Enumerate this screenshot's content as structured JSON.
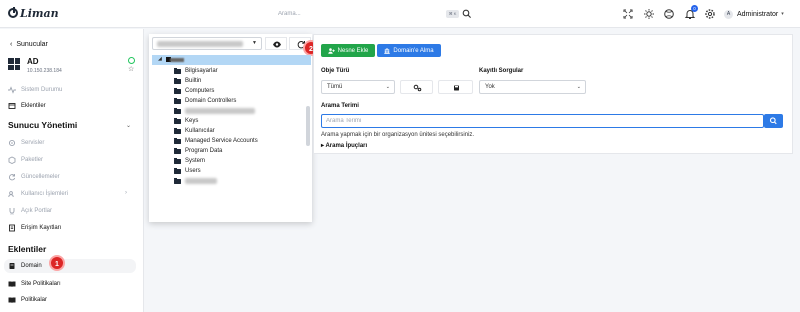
{
  "header": {
    "logo_text": "Liman",
    "search_placeholder": "Arama...",
    "search_shortcut": "⌘ K",
    "notification_count": "0",
    "user_initial": "A",
    "user_name": "Administrator"
  },
  "sidebar": {
    "back_label": "Sunucular",
    "server": {
      "name": "AD",
      "ip": "10.150.238.184"
    },
    "items_top": [
      {
        "label": "Sistem Durumu",
        "icon": "pulse-icon"
      },
      {
        "label": "Eklentiler",
        "icon": "plugin-icon"
      }
    ],
    "section_management": "Sunucu Yönetimi",
    "items_management": [
      {
        "label": "Servisler",
        "icon": "services-icon"
      },
      {
        "label": "Paketler",
        "icon": "package-icon"
      },
      {
        "label": "Güncellemeler",
        "icon": "update-icon"
      },
      {
        "label": "Kullanıcı İşlemleri",
        "icon": "users-icon"
      },
      {
        "label": "Açık Portlar",
        "icon": "port-icon"
      },
      {
        "label": "Erişim Kayıtları",
        "icon": "log-icon"
      }
    ],
    "section_plugins": "Eklentiler",
    "items_plugins": [
      {
        "label": "Domain",
        "icon": "domain-icon"
      },
      {
        "label": "Site Politikaları",
        "icon": "book-icon"
      },
      {
        "label": "Politikalar",
        "icon": "book-icon"
      }
    ]
  },
  "tree": {
    "items": [
      "Bilgisayarlar",
      "",
      "Builtin",
      "Computers",
      "Domain Controllers",
      "",
      "Keys",
      "Kullanıcılar",
      "Managed Service Accounts",
      "Program Data",
      "System",
      "Users",
      ""
    ]
  },
  "actions": {
    "add_object": "Nesne Ekle",
    "join_domain": "Domain'e Alma"
  },
  "form": {
    "object_type_label": "Obje Türü",
    "object_type_value": "Tümü",
    "saved_queries_label": "Kayıtlı Sorgular",
    "saved_queries_value": "Yok",
    "search_term_label": "Arama Terimi",
    "search_term_placeholder": "Arama Terimi",
    "hint": "Arama yapmak için bir organizasyon ünitesi seçebilirsiniz.",
    "tips": "Arama İpuçları"
  },
  "annotations": {
    "badge1": "1",
    "badge2": "2"
  },
  "colors": {
    "accent_blue": "#2d7ae6",
    "success_green": "#22a54a",
    "badge_red": "#dc2626",
    "tree_selected": "#b3d7f5"
  }
}
